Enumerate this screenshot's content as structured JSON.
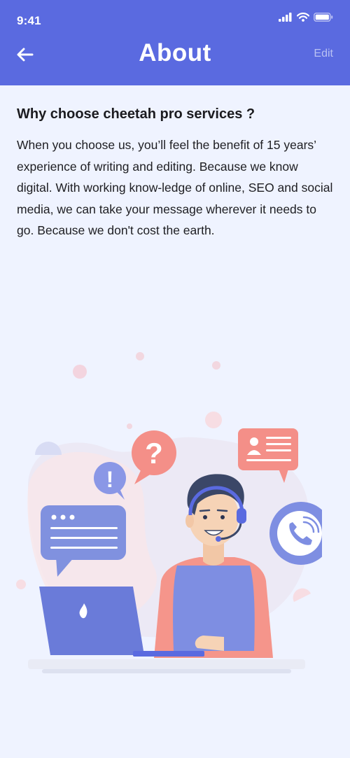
{
  "status_bar": {
    "time": "9:41",
    "icons": [
      "signal-icon",
      "wifi-icon",
      "battery-icon"
    ]
  },
  "header": {
    "title": "About",
    "edit_label": "Edit",
    "back_icon": "arrow-left-icon"
  },
  "about": {
    "heading": "Why choose cheetah pro services ?",
    "body": "When you choose us, you’ll feel the benefit of 15 years’ experience of writing and editing. Because we know digital. With working know-ledge of online, SEO and social media, we can take your message wherever it needs to go. Because we don't cost the earth."
  },
  "illustration": {
    "subject": "customer-support-agent",
    "question_mark": "?",
    "exclamation_mark": "!"
  },
  "colors": {
    "header_bg": "#5a6ae0",
    "page_bg": "#eff3ff",
    "accent_pink": "#f48f88",
    "accent_blue": "#7e8ee2"
  }
}
